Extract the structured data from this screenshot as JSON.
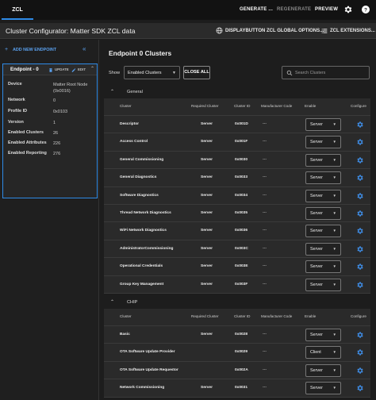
{
  "topbar": {
    "tab": "ZCL",
    "buttons": [
      "GENERATE ...",
      "REGENERATE",
      "PREVIEW"
    ],
    "colors": {
      "accent": "#2e8ae6",
      "disabled": "#8a8a8a"
    }
  },
  "titlebar": {
    "title": "Cluster Configurator: Matter SDK ZCL data",
    "global_options": "DISPLAYBUTTON ZCL GLOBAL OPTIONS...",
    "extensions": "ZCL EXTENSIONS..."
  },
  "sidebar": {
    "add_endpoint": "ADD NEW ENDPOINT",
    "endpoint": {
      "name": "Endpoint - 0",
      "update": "UPDATE",
      "edit": "EDIT",
      "device_label": "Device",
      "device_value": "Matter Root Node (0x0016)",
      "network_label": "Network",
      "network_value": "0",
      "profile_label": "Profile ID",
      "profile_value": "0x0103",
      "version_label": "Version",
      "version_value": "1",
      "clusters_label": "Enabled Clusters",
      "clusters_value": "26",
      "attributes_label": "Enabled Attributes",
      "attributes_value": "226",
      "reporting_label": "Enabled Reporting",
      "reporting_value": "276"
    }
  },
  "main": {
    "title": "Endpoint 0 Clusters",
    "show_label": "Show",
    "show_value": "Enabled Clusters",
    "close_all": "CLOSE ALL",
    "search_placeholder": "Search Clusters",
    "columns": [
      "Cluster",
      "Required Cluster",
      "Cluster ID",
      "Manufacturer Code",
      "Enable",
      "Configure"
    ],
    "groups": [
      {
        "name": "General",
        "rows": [
          {
            "cluster": "Descriptor",
            "required": "Server",
            "id": "0x001D",
            "mfg": "---",
            "enable": "Server"
          },
          {
            "cluster": "Access Control",
            "required": "Server",
            "id": "0x001F",
            "mfg": "---",
            "enable": "Server"
          },
          {
            "cluster": "General Commissioning",
            "required": "Server",
            "id": "0x0030",
            "mfg": "---",
            "enable": "Server"
          },
          {
            "cluster": "General Diagnostics",
            "required": "Server",
            "id": "0x0033",
            "mfg": "---",
            "enable": "Server"
          },
          {
            "cluster": "Software Diagnostics",
            "required": "Server",
            "id": "0x0034",
            "mfg": "---",
            "enable": "Server"
          },
          {
            "cluster": "Thread Network Diagnostics",
            "required": "Server",
            "id": "0x0035",
            "mfg": "---",
            "enable": "Server"
          },
          {
            "cluster": "WiFi Network Diagnostics",
            "required": "Server",
            "id": "0x0036",
            "mfg": "---",
            "enable": "Server"
          },
          {
            "cluster": "AdministratorCommissioning",
            "required": "Server",
            "id": "0x003C",
            "mfg": "---",
            "enable": "Server"
          },
          {
            "cluster": "Operational Credentials",
            "required": "Server",
            "id": "0x003E",
            "mfg": "---",
            "enable": "Server"
          },
          {
            "cluster": "Group Key Management",
            "required": "Server",
            "id": "0x003F",
            "mfg": "---",
            "enable": "Server"
          }
        ]
      },
      {
        "name": "CHIP",
        "rows": [
          {
            "cluster": "Basic",
            "required": "Server",
            "id": "0x0028",
            "mfg": "---",
            "enable": "Server"
          },
          {
            "cluster": "OTA Software Update Provider",
            "required": "",
            "id": "0x0029",
            "mfg": "---",
            "enable": "Client"
          },
          {
            "cluster": "OTA Software Update Requestor",
            "required": "",
            "id": "0x002A",
            "mfg": "---",
            "enable": "Server"
          },
          {
            "cluster": "Network Commissioning",
            "required": "Server",
            "id": "0x0031",
            "mfg": "---",
            "enable": "Server"
          }
        ]
      }
    ]
  }
}
